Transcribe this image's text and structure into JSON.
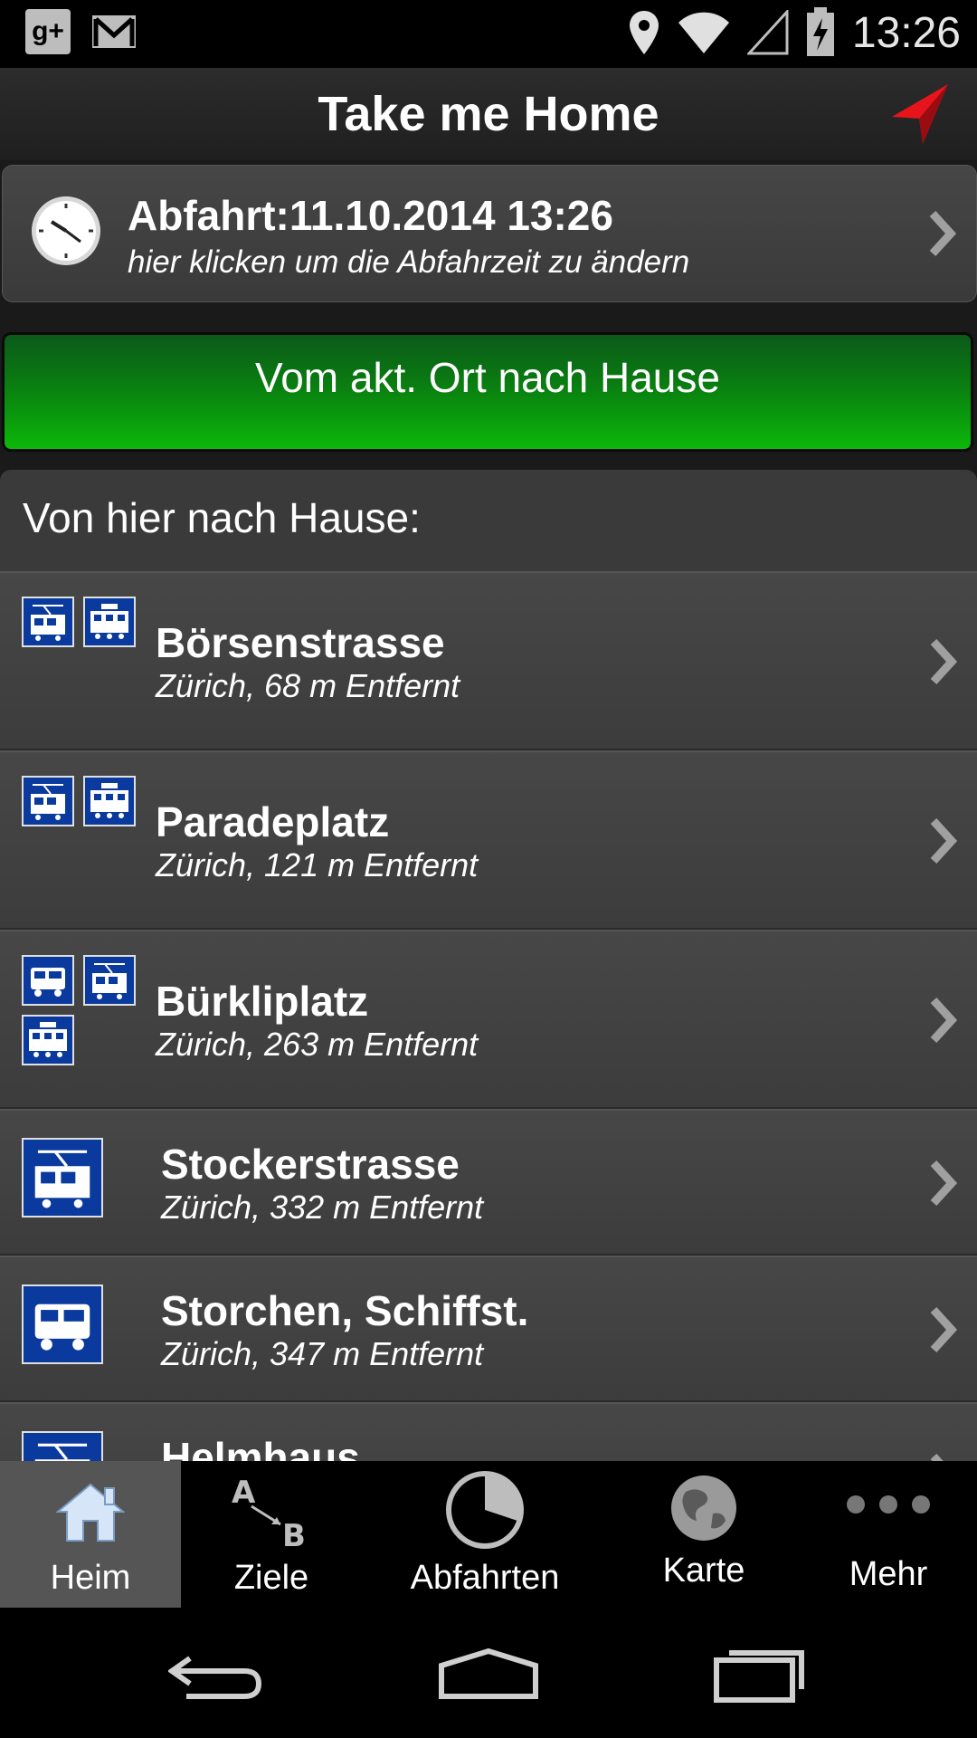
{
  "status_bar": {
    "time": "13:26",
    "gplus_label": "g+"
  },
  "action_bar": {
    "title": "Take me Home"
  },
  "departure": {
    "title": "Abfahrt:11.10.2014 13:26",
    "subtitle": "hier klicken um die Abfahrzeit zu ändern"
  },
  "home_button": {
    "label": "Vom akt. Ort nach Hause"
  },
  "list": {
    "header": "Von hier nach Hause:",
    "items": [
      {
        "name": "Börsenstrasse",
        "detail": "Zürich, 68 m Entfernt",
        "icons": [
          "tram-icon",
          "train-icon"
        ]
      },
      {
        "name": "Paradeplatz",
        "detail": "Zürich, 121 m Entfernt",
        "icons": [
          "tram-icon",
          "train-icon"
        ]
      },
      {
        "name": "Bürkliplatz",
        "detail": "Zürich, 263 m Entfernt",
        "icons": [
          "bus-icon",
          "tram-icon",
          "train-icon"
        ]
      },
      {
        "name": "Stockerstrasse",
        "detail": "Zürich, 332 m Entfernt",
        "icons": [
          "tram-icon"
        ]
      },
      {
        "name": "Storchen, Schiffst.",
        "detail": "Zürich, 347 m Entfernt",
        "icons": [
          "bus-icon"
        ]
      },
      {
        "name": "Helmhaus",
        "detail": "",
        "icons": [
          "tram-icon"
        ]
      }
    ]
  },
  "tabs": [
    {
      "label": "Heim",
      "icon": "home-icon",
      "active": true
    },
    {
      "label": "Ziele",
      "icon": "a-to-b-icon",
      "active": false
    },
    {
      "label": "Abfahrten",
      "icon": "timer-icon",
      "active": false
    },
    {
      "label": "Karte",
      "icon": "globe-icon",
      "active": false
    },
    {
      "label": "Mehr",
      "icon": "more-icon",
      "active": false
    }
  ],
  "colors": {
    "accent_green": "#0bb80a",
    "transit_blue": "#0a3a9e",
    "nav_arrow_red": "#e8141c"
  }
}
